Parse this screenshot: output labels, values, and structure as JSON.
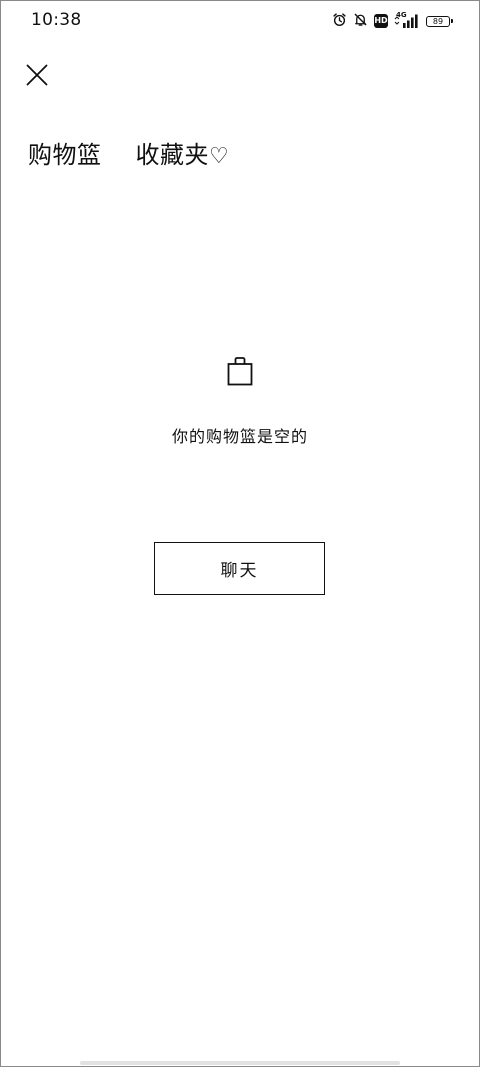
{
  "status_bar": {
    "time": "10:38",
    "network_label": "4G",
    "battery_level": "89",
    "icons": [
      "alarm-icon",
      "mute-bell-icon",
      "hd-icon",
      "signal-icon",
      "battery-icon"
    ],
    "hd_label": "HD"
  },
  "header": {
    "close_icon": "close-icon"
  },
  "tabs": [
    {
      "label": "购物篮"
    },
    {
      "label": "收藏夹",
      "icon": "♡"
    }
  ],
  "empty_state": {
    "icon": "shopping-bag-icon",
    "message": "你的购物篮是空的",
    "chat_button_label": "聊天"
  },
  "colors": {
    "text": "#111111",
    "background": "#ffffff",
    "border": "#111111"
  }
}
